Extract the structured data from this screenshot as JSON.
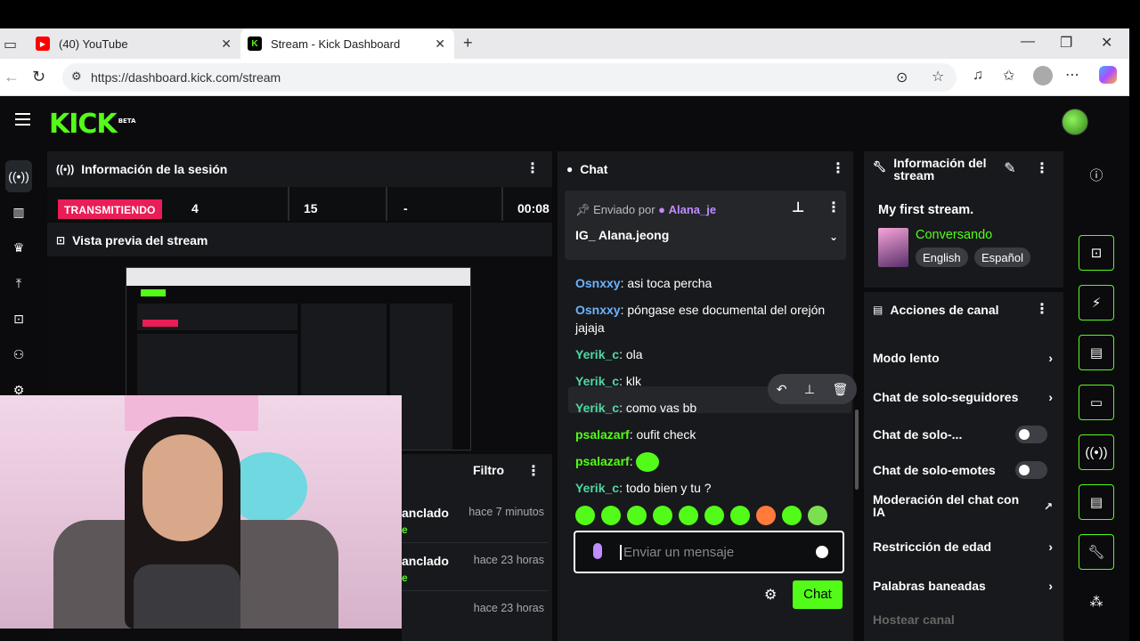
{
  "browser": {
    "tabs": [
      {
        "title": "(40) YouTube"
      },
      {
        "title": "Stream - Kick Dashboard"
      }
    ],
    "url": "https://dashboard.kick.com/stream"
  },
  "app": {
    "logo": "KICK",
    "logo_badge": "BETA"
  },
  "session": {
    "title": "Información de la sesión",
    "live_badge": "TRANSMITIENDO",
    "stats": [
      "4",
      "15",
      "-",
      "00:08"
    ]
  },
  "preview": {
    "title": "Vista previa del stream"
  },
  "events": {
    "filter_label": "Filtro",
    "rows": [
      {
        "title": "anclado",
        "time": "hace 7 minutos",
        "sub": "e"
      },
      {
        "title": "anclado",
        "time": "hace 23 horas",
        "sub": "e"
      },
      {
        "title": "",
        "time": "hace 23 horas",
        "sub": ""
      }
    ]
  },
  "chat": {
    "title": "Chat",
    "pinned": {
      "sent_by_label": "Enviado por",
      "author": "Alana_je",
      "message": "IG_ Alana.jeong"
    },
    "messages": [
      {
        "user": "Osnxxy",
        "text": "asi toca percha",
        "color": "blue"
      },
      {
        "user": "Osnxxy",
        "text": "póngase ese documental del orejón jajaja",
        "color": "blue"
      },
      {
        "user": "Yerik_c",
        "text": "ola",
        "color": "teal"
      },
      {
        "user": "Yerik_c",
        "text": "klk",
        "color": "teal"
      },
      {
        "user": "Yerik_c",
        "text": "como vas bb",
        "color": "teal"
      },
      {
        "user": "psalazarf",
        "text": "oufit check",
        "color": "green"
      },
      {
        "user": "psalazarf",
        "text": "",
        "color": "green"
      },
      {
        "user": "Yerik_c",
        "text": "todo bien y tu ?",
        "color": "teal"
      }
    ],
    "input_placeholder": "Enviar un mensaje",
    "send_label": "Chat"
  },
  "stream_info": {
    "title": "Información del stream",
    "stream_title": "My first stream.",
    "category": "Conversando",
    "tags": [
      "English",
      "Español"
    ]
  },
  "channel_actions": {
    "title": "Acciones de canal",
    "items": [
      {
        "label": "Modo lento",
        "control": "chevron"
      },
      {
        "label": "Chat de solo-seguidores",
        "control": "chevron"
      },
      {
        "label": "Chat de solo-...",
        "control": "toggle"
      },
      {
        "label": "Chat de solo-emotes",
        "control": "toggle"
      },
      {
        "label": "Moderación del chat con IA",
        "control": "external"
      },
      {
        "label": "Restricción de edad",
        "control": "chevron"
      },
      {
        "label": "Palabras baneadas",
        "control": "chevron"
      },
      {
        "label": "Hostear canal",
        "control": "chevron"
      }
    ]
  },
  "colors": {
    "brand_green": "#53fc18",
    "live_red": "#e91d57",
    "panel_bg": "#18191c"
  }
}
